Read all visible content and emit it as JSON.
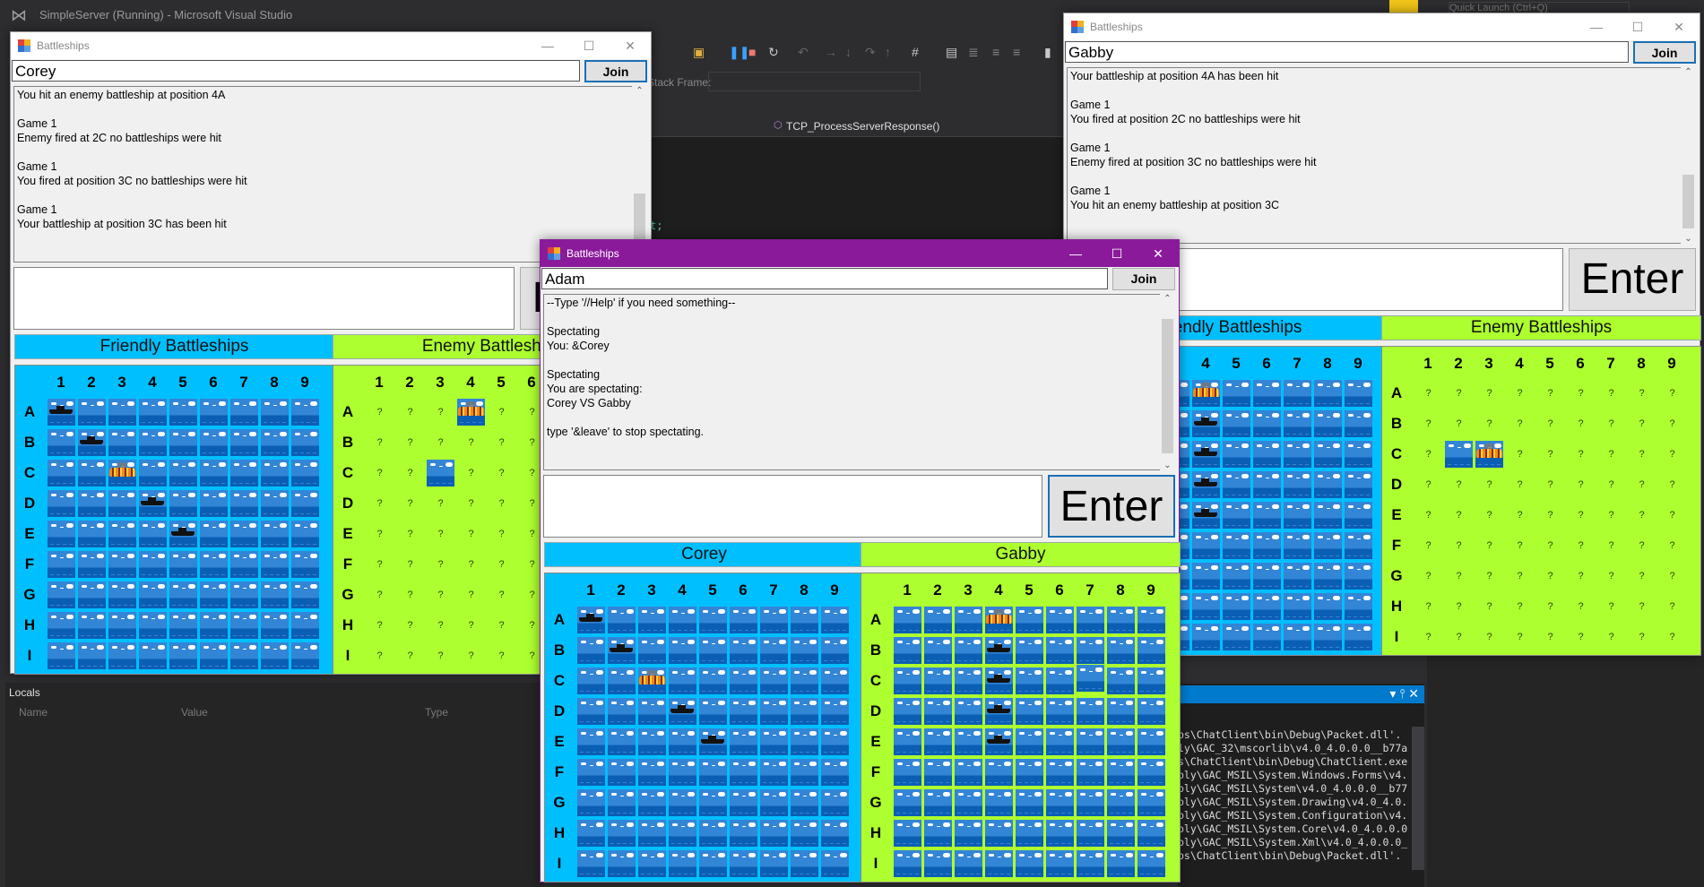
{
  "vs": {
    "window_title": "SimpleServer (Running) - Microsoft Visual Studio",
    "quick_launch_placeholder": "Quick Launch (Ctrl+Q)",
    "stack_frame_label": "Stack Frame:",
    "nav_function": "TCP_ProcessServerResponse()",
    "code_fragment": "t;",
    "locals": {
      "title": "Locals",
      "columns": [
        "Name",
        "Value",
        "Type"
      ]
    },
    "output_lines": [
      "ps\\ChatClient\\bin\\Debug\\Packet.dll'.",
      "ly\\GAC_32\\mscorlib\\v4.0_4.0.0.0__b77a",
      "s\\ChatClient\\bin\\Debug\\ChatClient.exe",
      "bly\\GAC_MSIL\\System.Windows.Forms\\v4.",
      "bly\\GAC_MSIL\\System\\v4.0_4.0.0.0__b77",
      "bly\\GAC_MSIL\\System.Drawing\\v4.0_4.0.",
      "bly\\GAC_MSIL\\System.Configuration\\v4.",
      "bly\\GAC_MSIL\\System.Core\\v4.0_4.0.0.0",
      "bly\\GAC_MSIL\\System.Xml\\v4.0_4.0.0.0_",
      "ps\\ChatClient\\bin\\Debug\\Packet.dll'."
    ]
  },
  "legend": {
    "W": "water",
    "S": "ship",
    "H": "hit-burning",
    "Q": "unknown",
    "unknown_glyph": "?"
  },
  "windows": {
    "corey": {
      "title": "Battleships",
      "name_value": "Corey",
      "join_label": "Join",
      "enter_label": "Enter",
      "message_value": "",
      "log": "You hit an enemy battleship at position 4A\n\nGame 1\nEnemy fired at 2C no battleships were hit\n\nGame 1\nYou fired at position 3C no battleships were hit\n\nGame 1\nYour battleship at position 3C has been hit",
      "left_header": "Friendly Battleships",
      "right_header": "Enemy Battleships",
      "left_board": [
        "SWWWWWWWW",
        "WSWWWWWWW",
        "WWHWWWWWW",
        "WWWSWWWWW",
        "WWWWSWWWW",
        "WWWWWWWWW",
        "WWWWWWWWW",
        "WWWWWWWWW",
        "WWWWWWWWW"
      ],
      "right_board": [
        "QQQHQQQQQ",
        "QQQQQQQQQ",
        "QQWQQQQQQ",
        "QQQQQQQQQ",
        "QQQQQQQQQ",
        "QQQQQQQQQ",
        "QQQQQQQQQ",
        "QQQQQQQQQ",
        "QQQQQQQQQ"
      ]
    },
    "gabby": {
      "title": "Battleships",
      "name_value": "Gabby",
      "join_label": "Join",
      "enter_label": "Enter",
      "message_value": "",
      "log": "Your battleship at position 4A has been hit\n\nGame 1\nYou fired at position 2C no battleships were hit\n\nGame 1\nEnemy fired at position 3C no battleships were hit\n\nGame 1\nYou hit an enemy battleship at position 3C",
      "left_header": "Friendly Battleships",
      "right_header": "Enemy Battleships",
      "left_board": [
        "WWWHWWWWW",
        "WWWSWWWWW",
        "WWWSWWWWW",
        "WWWSWWWWW",
        "WWWSWWWWW",
        "WWWWWWWWW",
        "WWWWWWWWW",
        "WWWWWWWWW",
        "WWWWWWWWW"
      ],
      "right_board": [
        "QQQQQQQQQ",
        "QQQQQQQQQ",
        "QWHQQQQQQ",
        "QQQQQQQQQ",
        "QQQQQQQQQ",
        "QQQQQQQQQ",
        "QQQQQQQQQ",
        "QQQQQQQQQ",
        "QQQQQQQQQ"
      ]
    },
    "adam": {
      "title": "Battleships",
      "name_value": "Adam",
      "join_label": "Join",
      "enter_label": "Enter",
      "message_value": "",
      "log": "--Type '//Help' if you need something--\n\nSpectating\nYou: &Corey\n\nSpectating\nYou are spectating:\nCorey VS Gabby\n\ntype '&leave' to stop spectating.",
      "left_header": "Corey",
      "right_header": "Gabby",
      "left_board": [
        "SWWWWWWWW",
        "WSWWWWWWW",
        "WWHWWWWWW",
        "WWWSWWWWW",
        "WWWWSWWWW",
        "WWWWWWWWW",
        "WWWWWWWWW",
        "WWWWWWWWW",
        "WWWWWWWWW"
      ],
      "right_board": [
        "WWWHWWWWW",
        "WWWSWWWWW",
        "WWWSWWWWW",
        "WWWSWWWWW",
        "WWWSWWWWW",
        "WWWWWWWWW",
        "WWWWWWWWW",
        "WWWWWWWWW",
        "WWWWWWWWW"
      ],
      "pressed_cell": "C7"
    }
  },
  "columns": [
    "1",
    "2",
    "3",
    "4",
    "5",
    "6",
    "7",
    "8",
    "9"
  ],
  "rows": [
    "A",
    "B",
    "C",
    "D",
    "E",
    "F",
    "G",
    "H",
    "I"
  ],
  "titlebar_buttons": {
    "minimize": "—",
    "maximize": "☐",
    "close": "✕"
  },
  "colors": {
    "friendly": "#00bfff",
    "enemy": "#adff2f",
    "active_titlebar": "#8b1a9b"
  }
}
